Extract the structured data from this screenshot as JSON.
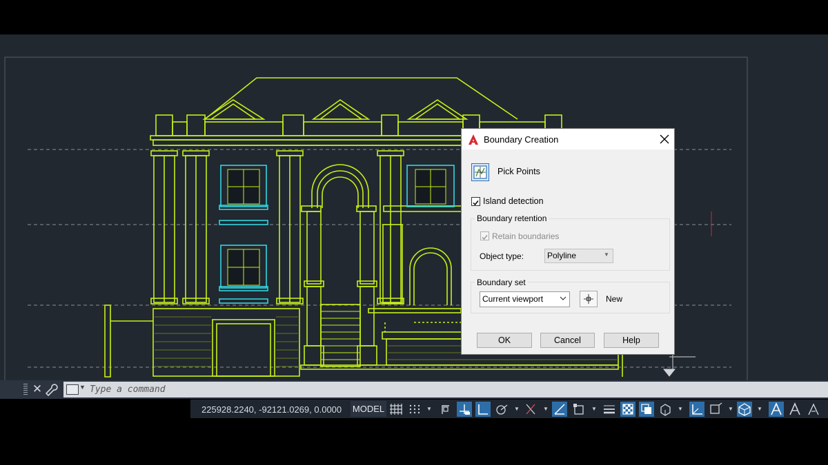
{
  "dialog": {
    "title": "Boundary Creation",
    "pick_points": "Pick Points",
    "island_detection": "Island detection",
    "boundary_retention_title": "Boundary retention",
    "retain_boundaries": "Retain boundaries",
    "object_type_label": "Object type:",
    "object_type_value": "Polyline",
    "boundary_set_title": "Boundary set",
    "boundary_set_value": "Current viewport",
    "new_label": "New",
    "ok": "OK",
    "cancel": "Cancel",
    "help": "Help",
    "island_checked": true,
    "retain_checked": true
  },
  "command_line": {
    "placeholder": "Type a command"
  },
  "status_bar": {
    "coordinates": "225928.2240, -92121.0269, 0.0000",
    "model": "MODEL",
    "icons": [
      "grid-icon",
      "snap-icon",
      "infer-constraints-icon",
      "dynamic-input-icon",
      "ortho-icon",
      "polar-icon",
      "isodraft-icon",
      "object-snap-tracking-icon",
      "object-snap-icon",
      "lineweight-icon",
      "transparency-icon",
      "selection-cycling-icon",
      "3d-osnap-icon",
      "dynamic-ucs-icon",
      "selection-filter-icon",
      "gizmo-icon",
      "annotation-visibility-icon",
      "auto-scale-icon",
      "annotation-scale-icon"
    ]
  },
  "colors": {
    "canvas": "#212830",
    "linework": "#c8f016",
    "windows": "#33d6e0",
    "accent": "#2d6ea8"
  }
}
